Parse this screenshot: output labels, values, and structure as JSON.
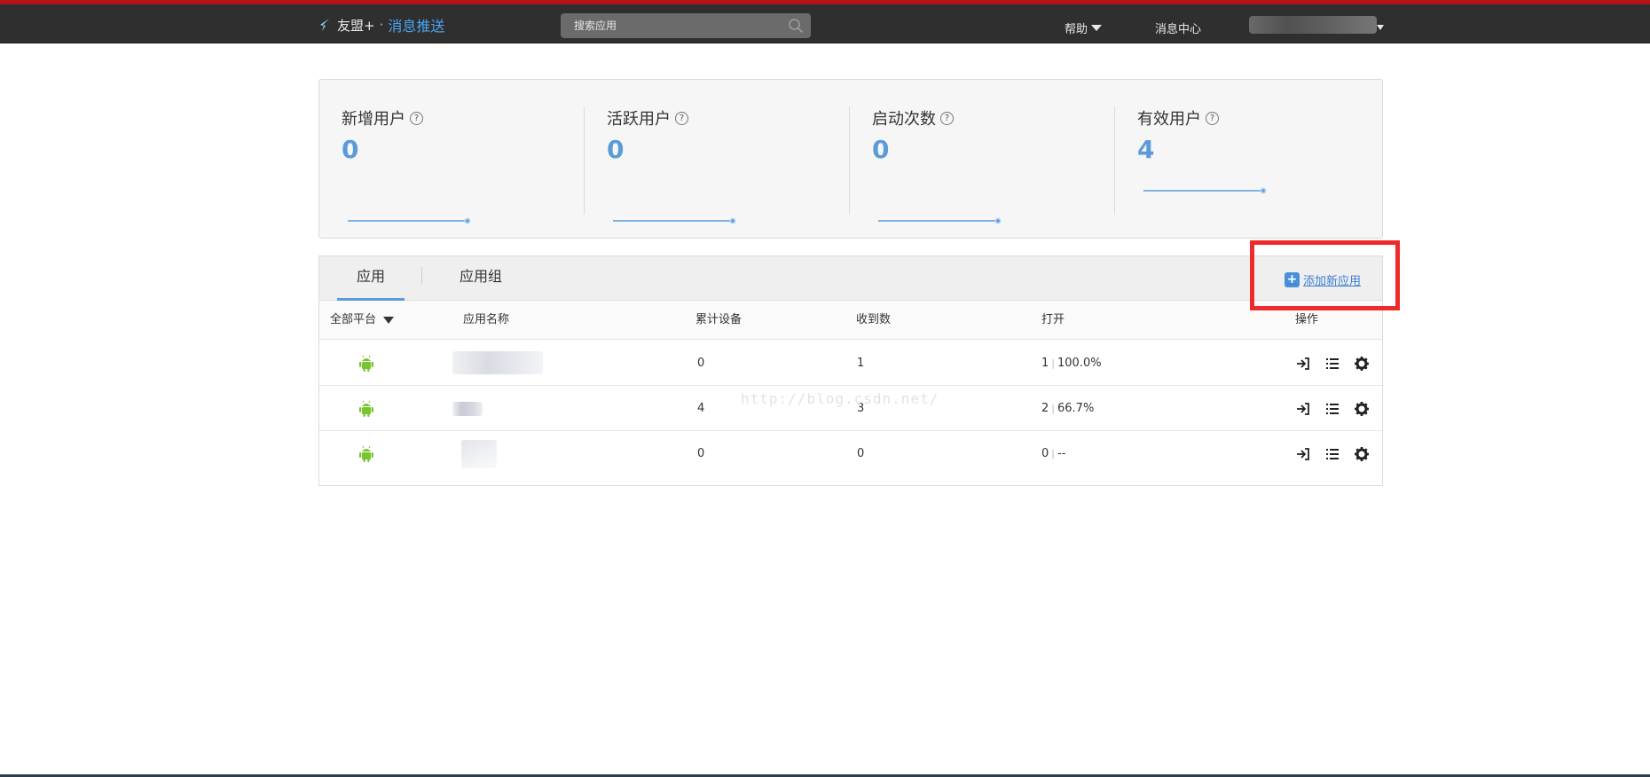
{
  "header": {
    "brand": "友盟+",
    "separator": "·",
    "product": "消息推送",
    "search_placeholder": "搜索应用",
    "help_label": "帮助",
    "message_center_label": "消息中心"
  },
  "stats": [
    {
      "label": "新增用户",
      "value": "0",
      "trend": [
        0,
        0
      ]
    },
    {
      "label": "活跃用户",
      "value": "0",
      "trend": [
        0,
        0
      ]
    },
    {
      "label": "启动次数",
      "value": "0",
      "trend": [
        0,
        0
      ]
    },
    {
      "label": "有效用户",
      "value": "4",
      "trend": [
        4,
        4
      ]
    }
  ],
  "tabs": [
    {
      "label": "应用",
      "active": true
    },
    {
      "label": "应用组",
      "active": false
    }
  ],
  "add_app_label": "添加新应用",
  "table": {
    "headers": {
      "platform": "全部平台",
      "name": "应用名称",
      "devices": "累计设备",
      "received": "收到数",
      "open": "打开",
      "ops": "操作"
    },
    "rows": [
      {
        "platform": "android",
        "devices": "0",
        "received": "1",
        "open_count": "1",
        "open_rate": "100.0%"
      },
      {
        "platform": "android",
        "devices": "4",
        "received": "3",
        "open_count": "2",
        "open_rate": "66.7%"
      },
      {
        "platform": "android",
        "devices": "0",
        "received": "0",
        "open_count": "0",
        "open_rate": "--"
      }
    ]
  },
  "watermark": "http://blog.csdn.net/",
  "colors": {
    "accent": "#5b9bd8",
    "topbar": "#2f2f30",
    "highlight": "#ee2a2a",
    "android": "#78c431"
  }
}
